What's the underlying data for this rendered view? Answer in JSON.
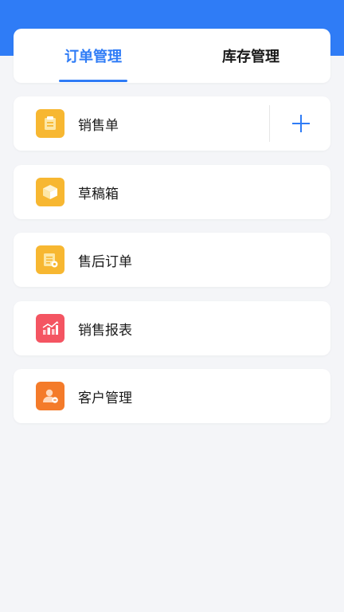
{
  "tabs": [
    {
      "label": "订单管理",
      "active": true
    },
    {
      "label": "库存管理",
      "active": false
    }
  ],
  "menu": [
    {
      "label": "销售单",
      "icon": "clipboard-icon",
      "color": "#f7b731"
    },
    {
      "label": "草稿箱",
      "icon": "box-icon",
      "color": "#f7b731"
    },
    {
      "label": "售后订单",
      "icon": "after-sales-document-icon",
      "color": "#f7b731"
    },
    {
      "label": "销售报表",
      "icon": "chart-icon",
      "color": "#f45562"
    },
    {
      "label": "客户管理",
      "icon": "customer-icon",
      "color": "#f47b2a"
    }
  ],
  "colors": {
    "accent": "#2f7cf6",
    "background": "#f4f5f8"
  }
}
